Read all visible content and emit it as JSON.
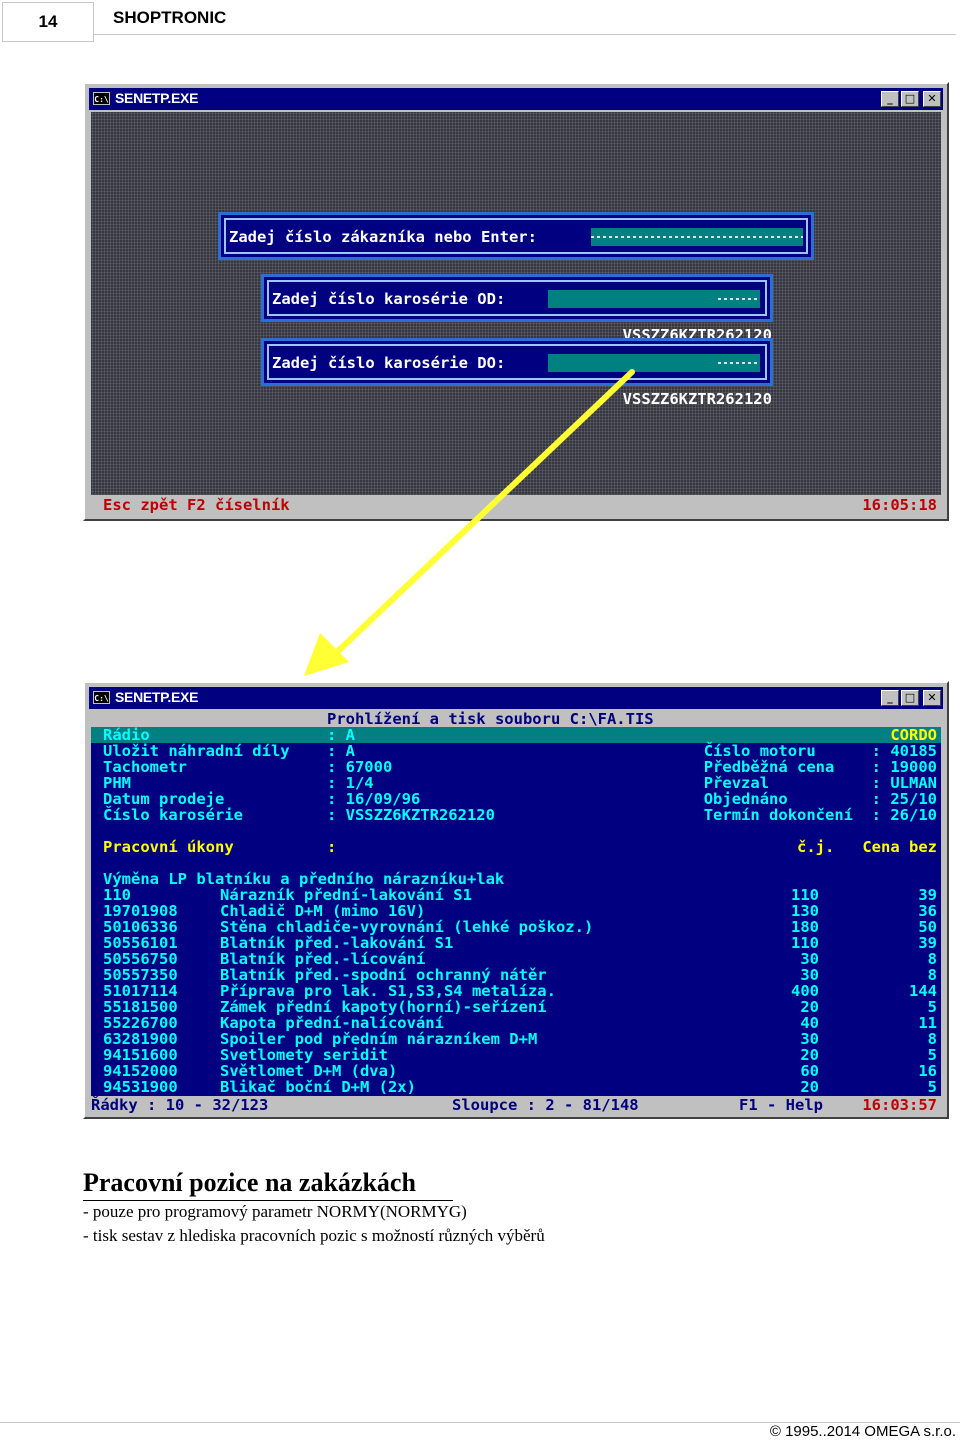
{
  "page": {
    "number": "14",
    "title": "SHOPTRONIC"
  },
  "window1": {
    "title": "SENETP.EXE",
    "icon": "C:\\",
    "prompt": "Zadej číslo zákazníka nebo Enter:",
    "od_label": "Zadej číslo karosérie OD:",
    "od_value": "VSSZZ6KZTR262120",
    "do_label": "Zadej číslo karosérie DO:",
    "do_value": "VSSZZ6KZTR262120",
    "status_left": "Esc zpět F2 číselník",
    "status_time": "16:05:18"
  },
  "window2": {
    "title": "SENETP.EXE",
    "icon": "C:\\",
    "header": "Prohlížení a tisk souboru C:\\FA.TIS",
    "radio": "Rádio                   : A",
    "cordo": "CORDO",
    "left_rows": [
      "Uložit náhradní díly    : A",
      "Tachometr               : 67000",
      "PHM                     : 1/4",
      "Datum prodeje           : 16/09/96",
      "Číslo karosérie         : VSSZZ6KZTR262120"
    ],
    "right_rows": [
      "Číslo motoru      : 40185",
      "Předběžná cena    : 19000",
      "Převzal           : ULMAN",
      "Objednáno         : 25/10",
      "Termín dokončení  : 26/10"
    ],
    "ukony_left": "Pracovní úkony          :",
    "ukony_right": "č.j.   Cena bez",
    "section": "Výměna LP blatníku a předního nárazníku+lak",
    "items": [
      {
        "code": "110",
        "desc": "Nárazník přední-lakování S1",
        "cj": "110",
        "price": "39"
      },
      {
        "code": "19701908",
        "desc": "Chladič D+M (mimo 16V)",
        "cj": "130",
        "price": "36"
      },
      {
        "code": "50106336",
        "desc": "Stěna chladiče-vyrovnání (lehké poškoz.)",
        "cj": "180",
        "price": "50"
      },
      {
        "code": "50556101",
        "desc": "Blatník před.-lakování S1",
        "cj": "110",
        "price": "39"
      },
      {
        "code": "50556750",
        "desc": "Blatník před.-lícování",
        "cj": "30",
        "price": "8"
      },
      {
        "code": "50557350",
        "desc": "Blatník před.-spodní ochranný nátěr",
        "cj": "30",
        "price": "8"
      },
      {
        "code": "51017114",
        "desc": "Příprava pro lak. S1,S3,S4 metalíza.",
        "cj": "400",
        "price": "144"
      },
      {
        "code": "55181500",
        "desc": "Zámek přední kapoty(horní)-seřízení",
        "cj": "20",
        "price": "5"
      },
      {
        "code": "55226700",
        "desc": "Kapota přední-nalícování",
        "cj": "40",
        "price": "11"
      },
      {
        "code": "63281900",
        "desc": "Spoiler pod předním nárazníkem D+M",
        "cj": "30",
        "price": "8"
      },
      {
        "code": "94151600",
        "desc": "Svetlomety seridit",
        "cj": "20",
        "price": "5"
      },
      {
        "code": "94152000",
        "desc": "Světlomet D+M (dva)",
        "cj": "60",
        "price": "16"
      },
      {
        "code": "94531900",
        "desc": "Blikač boční D+M (2x)",
        "cj": "20",
        "price": "5"
      }
    ],
    "status_rows": "Řádky : 10 - 32/123",
    "status_cols": "Sloupce : 2 - 81/148",
    "status_help": "F1 - Help",
    "status_time": "16:03:57"
  },
  "caption": {
    "heading": "Pracovní pozice na zakázkách",
    "line1": "- pouze pro programový parametr NORMY(NORMYG)",
    "line2": "- tisk sestav z hlediska pracovních pozic s možností různých výběrů"
  },
  "footer": "© 1995..2014 OMEGA s.r.o.",
  "colors": {
    "arrow": "#ffff33",
    "console_blue": "#000080",
    "highlight": "#008080"
  }
}
